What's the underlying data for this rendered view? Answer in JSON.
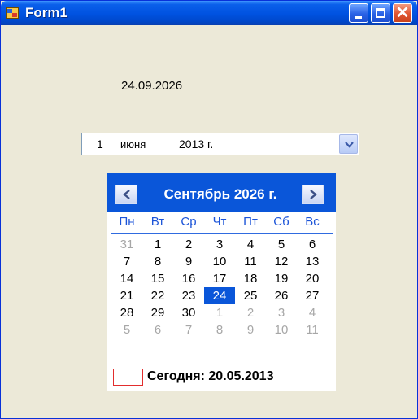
{
  "window": {
    "title": "Form1"
  },
  "label": {
    "date": "24.09.2026"
  },
  "picker": {
    "day": "1",
    "month": "июня",
    "year": "2013 г."
  },
  "calendar": {
    "title": "Сентябрь 2026 г.",
    "weekdays": [
      "Пн",
      "Вт",
      "Ср",
      "Чт",
      "Пт",
      "Сб",
      "Вс"
    ],
    "weeks": [
      [
        {
          "d": "31",
          "other": true
        },
        {
          "d": "1"
        },
        {
          "d": "2"
        },
        {
          "d": "3"
        },
        {
          "d": "4"
        },
        {
          "d": "5"
        },
        {
          "d": "6"
        }
      ],
      [
        {
          "d": "7"
        },
        {
          "d": "8"
        },
        {
          "d": "9"
        },
        {
          "d": "10"
        },
        {
          "d": "11"
        },
        {
          "d": "12"
        },
        {
          "d": "13"
        }
      ],
      [
        {
          "d": "14"
        },
        {
          "d": "15"
        },
        {
          "d": "16"
        },
        {
          "d": "17"
        },
        {
          "d": "18"
        },
        {
          "d": "19"
        },
        {
          "d": "20"
        }
      ],
      [
        {
          "d": "21"
        },
        {
          "d": "22"
        },
        {
          "d": "23"
        },
        {
          "d": "24",
          "selected": true
        },
        {
          "d": "25"
        },
        {
          "d": "26"
        },
        {
          "d": "27"
        }
      ],
      [
        {
          "d": "28"
        },
        {
          "d": "29"
        },
        {
          "d": "30"
        },
        {
          "d": "1",
          "other": true
        },
        {
          "d": "2",
          "other": true
        },
        {
          "d": "3",
          "other": true
        },
        {
          "d": "4",
          "other": true
        }
      ],
      [
        {
          "d": "5",
          "other": true
        },
        {
          "d": "6",
          "other": true
        },
        {
          "d": "7",
          "other": true
        },
        {
          "d": "8",
          "other": true
        },
        {
          "d": "9",
          "other": true
        },
        {
          "d": "10",
          "other": true
        },
        {
          "d": "11",
          "other": true
        }
      ]
    ],
    "today_label": "Сегодня: 20.05.2013"
  },
  "colors": {
    "titlebar": "#0052e0",
    "calendar_header": "#0a56d9",
    "selected_day": "#0a56d9",
    "today_marker": "#e22d2d",
    "weekday_text": "#1c54d8"
  },
  "icons": {
    "app": "form-icon",
    "minimize": "minimize-icon",
    "maximize": "maximize-icon",
    "close": "close-icon",
    "dropdown": "chevron-down-icon",
    "prev": "chevron-left-icon",
    "next": "chevron-right-icon"
  }
}
